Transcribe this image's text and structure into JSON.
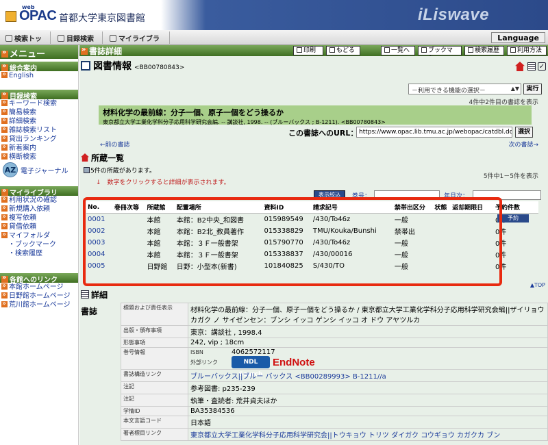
{
  "header": {
    "logo_small": "web",
    "logo_main": "OPAC",
    "library_name": "首都大学東京図書館",
    "brand": "iLiswave"
  },
  "nav": {
    "tabs": [
      "検索トップ",
      "目録検索",
      "マイライブラリ"
    ],
    "language": "Language"
  },
  "sidebar": {
    "menu_title": "メニュー",
    "sections": [
      {
        "title": "総合案内",
        "items": [
          "English"
        ]
      },
      {
        "title": "目録検索",
        "items": [
          "キーワード検索",
          "簡易検索",
          "詳細検索",
          "雑誌検索リスト",
          "貸出ランキング",
          "新着案内",
          "横断検索"
        ]
      },
      {
        "title": "マイライブラリ",
        "items": [
          "利用状況の確認",
          "新規購入依頼",
          "複写依頼",
          "貸借依頼",
          "マイフォルダ"
        ],
        "subitems": [
          "ブックマーク",
          "検索履歴"
        ]
      },
      {
        "title": "各館へのリンク",
        "items": [
          "本館ホームページ",
          "日野館ホームページ",
          "荒川館ホームページ"
        ]
      }
    ],
    "ejournal": "電子ジャーナル",
    "az": "AZ"
  },
  "toolbar": {
    "title": "書誌詳細",
    "buttons": [
      "印刷",
      "もどる",
      "一覧へ",
      "ブックマーク",
      "検索履歴",
      "利用方法"
    ]
  },
  "bib": {
    "heading": "図書情報",
    "id": "<BB00780843>",
    "function_select": "－利用できる機能の選択－",
    "exec": "実行",
    "count": "4件中2件目の書誌を表示",
    "title_line": "材料化学の最前線：分子一個、原子一個をどう操るか",
    "sub_line": "東京都立大学工業化学科分子応用科学研究会編. -- 講談社, 1998. -- (ブルーバックス ; B-1211).  <BB00780843>",
    "url_label": "この書誌へのURL：",
    "url": "https://www.opac.lib.tmu.ac.jp/webopac/catdbl.do?pkey",
    "select": "選択",
    "prev": "←前の書誌",
    "next": "次の書誌→"
  },
  "holdings": {
    "heading": "所蔵一覧",
    "count_text": "5件の所蔵があります。",
    "note": "↓　数字をクリックすると詳細が表示されます。",
    "range": "5件中1－5件を表示",
    "narrow": "表示絞込",
    "vol_label": "巻号：",
    "year_label": "年月次：",
    "columns": [
      "No.",
      "巻冊次等",
      "所蔵館",
      "配置場所",
      "資料ID",
      "請求記号",
      "禁帯出区分",
      "状態",
      "返却期限日",
      "予約件数"
    ],
    "rows": [
      {
        "no": "0001",
        "vol": "",
        "lib": "本館",
        "loc": "本館：B2中央_和図書",
        "id": "015989549",
        "call": "/430/To46z",
        "restrict": "一般",
        "status": "",
        "due": "",
        "res": "0件"
      },
      {
        "no": "0002",
        "vol": "",
        "lib": "本館",
        "loc": "本館：B2北_教員著作",
        "id": "015338829",
        "call": "TMU/Kouka/Bunshi",
        "restrict": "禁帯出",
        "status": "",
        "due": "",
        "res": "0件"
      },
      {
        "no": "0003",
        "vol": "",
        "lib": "本館",
        "loc": "本館：３Ｆ一般書架",
        "id": "015790770",
        "call": "/430/To46z",
        "restrict": "一般",
        "status": "",
        "due": "",
        "res": "0件"
      },
      {
        "no": "0004",
        "vol": "",
        "lib": "本館",
        "loc": "本館：３Ｆ一般書架",
        "id": "015338837",
        "call": "/430/00016",
        "restrict": "一般",
        "status": "",
        "due": "",
        "res": "0件"
      },
      {
        "no": "0005",
        "vol": "",
        "lib": "日野館",
        "loc": "日野：小型本(新書)",
        "id": "101840825",
        "call": "S/430/TO",
        "restrict": "一般",
        "status": "",
        "due": "",
        "res": "0件"
      }
    ],
    "reserve": "予約",
    "top": "▲TOP"
  },
  "detail": {
    "heading": "詳細",
    "category": "書誌",
    "rows": [
      {
        "label": "標題および責任表示",
        "value": "材料化学の最前線：分子一個、原子一個をどう操るか / 東京都立大学工業化学科分子応用科学研究会編||ザイリョウ カガク ノ サイゼンセン：ブンシ イッコ ゲンシ イッコ オ ドウ アヤツルカ"
      },
      {
        "label": "出版・頒布事項",
        "value": "東京：講談社 , 1998.4"
      },
      {
        "label": "形態事項",
        "value": "242, vip ; 18cm"
      },
      {
        "label": "巻号情報",
        "isbn_label": "ISBN",
        "isbn": "4062572117",
        "ext_label": "外部リンク",
        "ndl": "NDL Search",
        "endnote": "EndNote"
      },
      {
        "label": "書誌構造リンク",
        "value": "ブルーバックス||ブルー バックス <BB00289993> B-1211//a"
      },
      {
        "label": "注記",
        "value": "参考図書: p235-239"
      },
      {
        "label": "注記",
        "value": "執筆・査読者: 荒井貞夫ほか"
      },
      {
        "label": "学情ID",
        "value": "BA35384536"
      },
      {
        "label": "本文言語コード",
        "value": "日本語"
      },
      {
        "label": "著者標目リンク",
        "value": "東京都立大学工業化学科分子応用科学研究会||トウキョウ トリツ ダイガク コウギョウ カガクカ ブン"
      }
    ]
  }
}
